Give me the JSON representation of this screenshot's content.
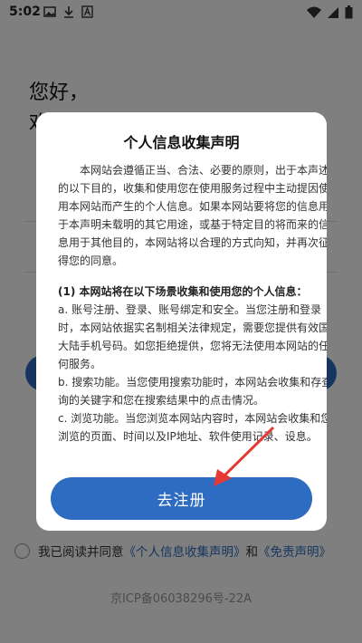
{
  "status": {
    "time": "5:02"
  },
  "background": {
    "greeting_line1": "您好，",
    "greeting_line2": "欢迎",
    "agree_prefix": "我已阅读并同意",
    "agree_link1": "《个人信息收集声明》",
    "agree_and": "和",
    "agree_link2": "《免责声明》",
    "icp": "京ICP备06038296号-22A"
  },
  "modal": {
    "title": "个人信息收集声明",
    "intro": "本网站会遵循正当、合法、必要的原则，出于本声述的以下目的，收集和使用您在使用服务过程中主动提因使用本网站而产生的个人信息。如果本网站要将您的信息用于本声明未载明的其它用途，或基于特定目的将而来的信息用于其他目的，本网站将以合理的方式向知，并再次征得您的同意。",
    "section_title": "(1) 本网站将在以下场景收集和使用您的个人信息：",
    "items": [
      "a. 账号注册、登录、账号绑定和安全。当您注册和登录时，本网站依据实名制相关法律规定，需要您提供有效国大陆手机号码。如您拒绝提供，您将无法使用本网站的任何服务。",
      "b. 搜索功能。当您使用搜索功能时，本网站会收集和存查询的关键字和您在搜索结果中的点击情况。",
      "c. 浏览功能。当您浏览本网站内容时，本网站会收集和您浏览的页面、时间以及IP地址、软件使用记录、设息。"
    ],
    "confirm_label": "去注册"
  },
  "colors": {
    "accent": "#2d6cc1",
    "arrow": "#e53935"
  }
}
